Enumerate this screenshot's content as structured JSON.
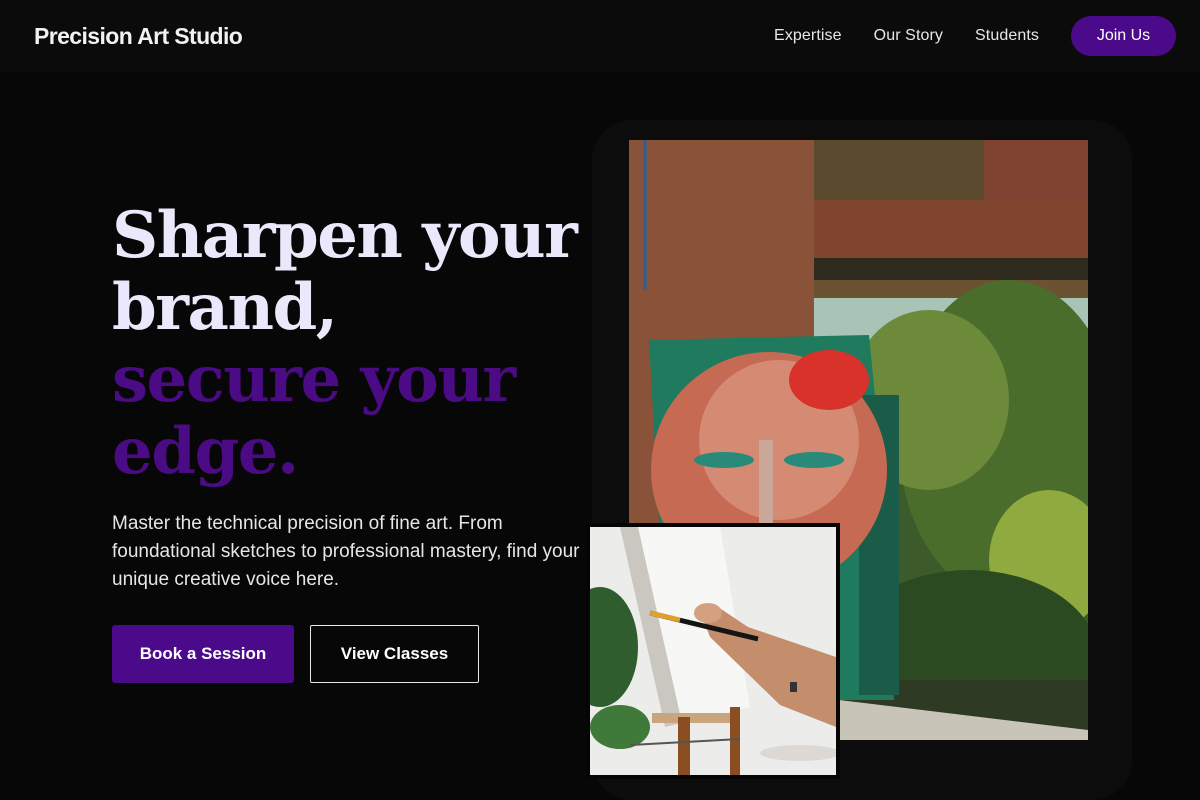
{
  "nav": {
    "brand": "Precision Art Studio",
    "links": [
      "Expertise",
      "Our Story",
      "Students"
    ],
    "cta": "Join Us"
  },
  "hero": {
    "headline_light": [
      "Sharpen your",
      "brand,"
    ],
    "headline_accent": [
      "secure your",
      "edge."
    ],
    "lead": "Master the technical precision of fine art. From foundational sketches to professional mastery, find your unique creative voice here.",
    "primary_button": "Book a Session",
    "secondary_button": "View Classes"
  },
  "images": {
    "main": "painted-face-portrait-window-photo",
    "secondary": "hand-painting-canvas-photo"
  },
  "colors": {
    "background": "#070707",
    "nav_background": "#0b0b0b",
    "accent": "#4b0a8a",
    "headline_light": "#ece8fb"
  }
}
